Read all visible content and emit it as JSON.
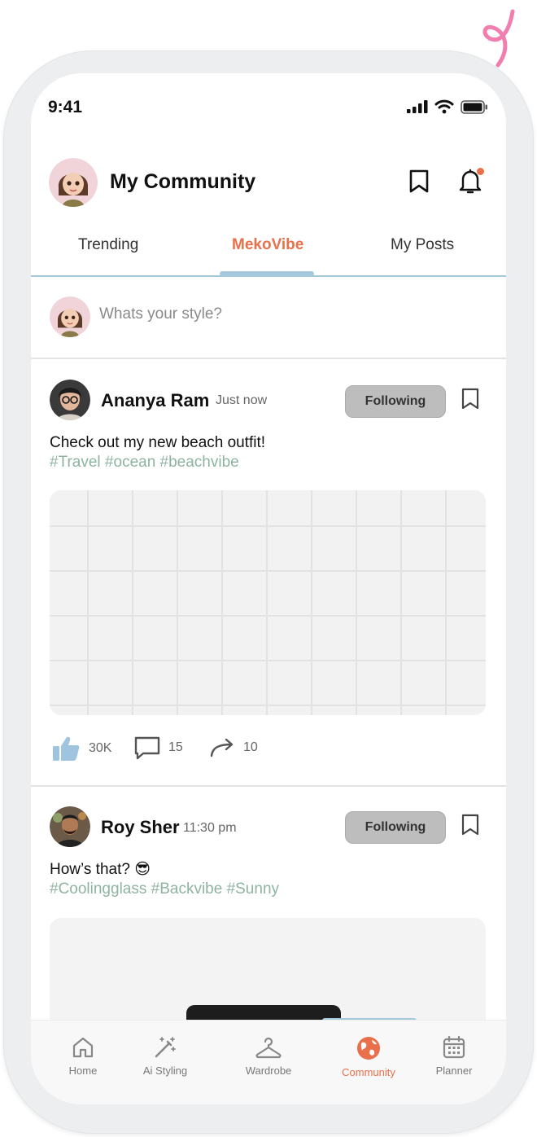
{
  "status_bar": {
    "time": "9:41"
  },
  "header": {
    "title": "My Community"
  },
  "tabs": [
    {
      "label": "Trending"
    },
    {
      "label": "MekoVibe",
      "active": true
    },
    {
      "label": "My Posts"
    }
  ],
  "composer": {
    "placeholder": "Whats your style?"
  },
  "posts": [
    {
      "author": "Ananya Ram",
      "time": "Just now",
      "follow_label": "Following",
      "caption": "Check out my new beach outfit!",
      "tags": "#Travel #ocean #beachvibe",
      "likes": "30K",
      "comments": "15",
      "shares": "10"
    },
    {
      "author": "Roy Sher",
      "time": "11:30 pm",
      "follow_label": "Following",
      "caption": "How’s that? 😎",
      "tags": "#Coolingglass #Backvibe #Sunny"
    }
  ],
  "bottom_nav": [
    {
      "label": "Home",
      "icon": "home-icon"
    },
    {
      "label": "Ai Styling",
      "icon": "magic-wand-icon"
    },
    {
      "label": "Wardrobe",
      "icon": "hanger-icon"
    },
    {
      "label": "Community",
      "icon": "globe-icon",
      "active": true
    },
    {
      "label": "Planner",
      "icon": "calendar-icon"
    }
  ],
  "colors": {
    "accent": "#e8704a",
    "tab_underline": "#a6c8dd",
    "hashtag": "#8fb3a2",
    "like": "#9fc4df",
    "follow_button": "#bdbdbd"
  }
}
